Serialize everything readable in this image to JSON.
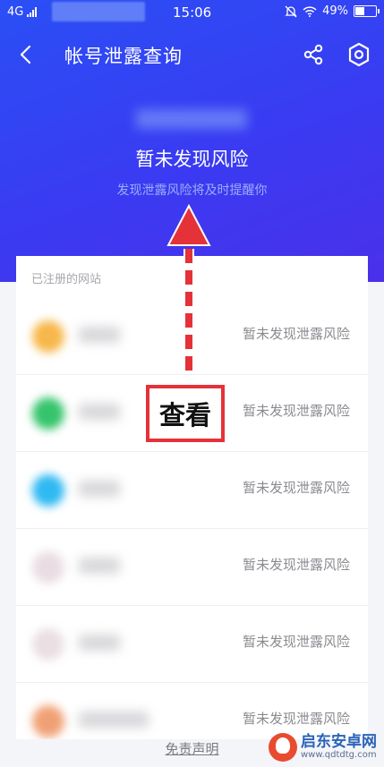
{
  "status_bar": {
    "network": "4G",
    "time": "15:06",
    "battery": "49%"
  },
  "header": {
    "title": "帐号泄露查询"
  },
  "summary": {
    "title": "暂未发现风险",
    "subtitle": "发现泄露风险将及时提醒你"
  },
  "sites": {
    "label": "已注册的网站",
    "items": [
      {
        "status": "暂未发现泄露风险",
        "logo_color": "#f7b74a"
      },
      {
        "status": "暂未发现泄露风险",
        "logo_color": "#35c46b"
      },
      {
        "status": "暂未发现泄露风险",
        "logo_color": "#2fb9f2"
      },
      {
        "status": "暂未发现泄露风险",
        "logo_color": "#e9dde3"
      },
      {
        "status": "暂未发现泄露风险",
        "logo_color": "#eadfe2"
      },
      {
        "status": "暂未发现泄露风险",
        "logo_color": "#f0a075"
      }
    ]
  },
  "footer": {
    "disclaimer": "免责声明"
  },
  "annotation": {
    "badge": "查看",
    "color": "#e53238"
  },
  "watermark": {
    "name": "启东安卓网",
    "url": "www.qdtdtg.com"
  }
}
